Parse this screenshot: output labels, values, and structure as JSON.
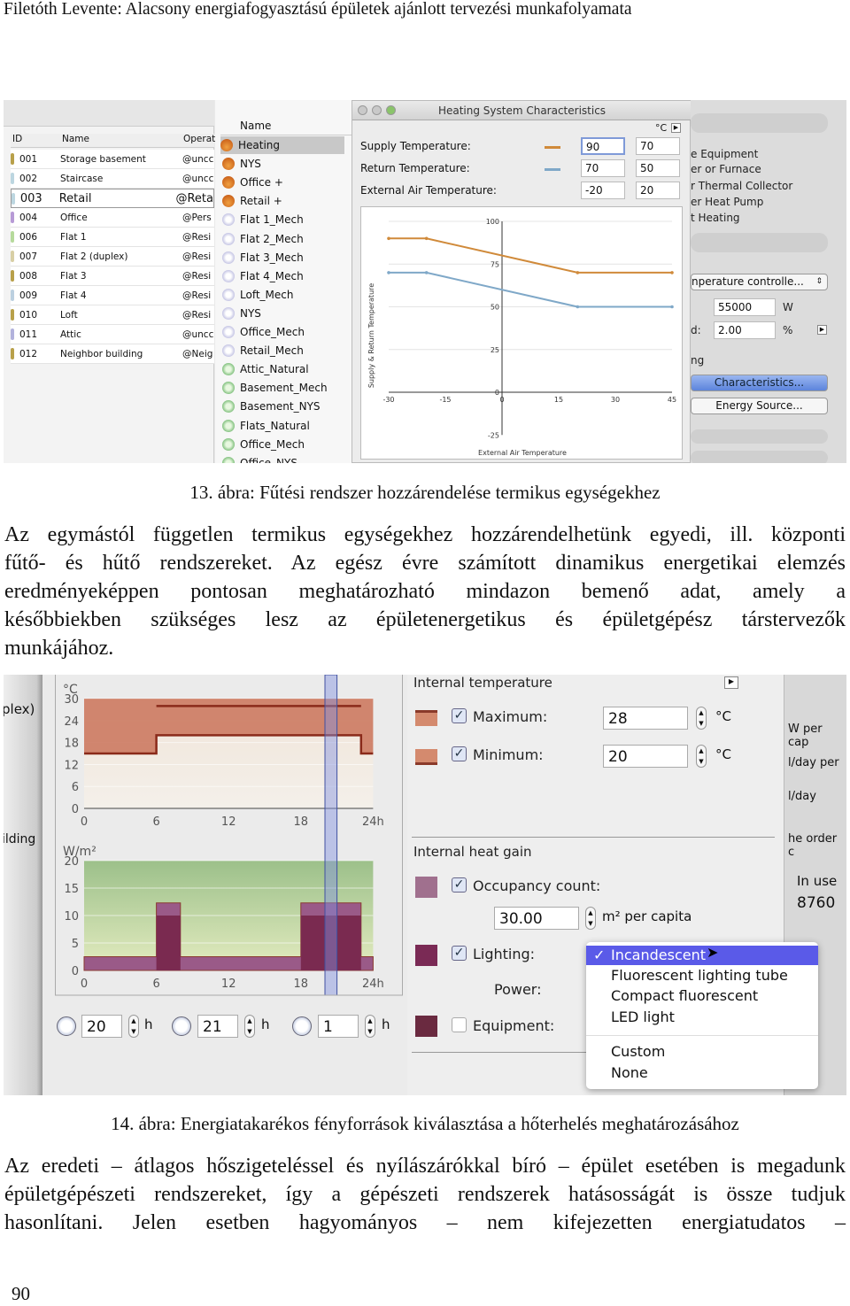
{
  "header": "Filetóth Levente: Alacsony energiafogyasztású épületek ajánlott tervezési munkafolyamata",
  "figure13": {
    "table": {
      "columns": [
        "ID",
        "Name",
        "Operat"
      ],
      "rows": [
        {
          "id": "001",
          "name": "Storage basement",
          "op": "@uncc",
          "color": "#b8a04a"
        },
        {
          "id": "002",
          "name": "Staircase",
          "op": "@uncc",
          "color": "#bcd6e0"
        },
        {
          "id": "003",
          "name": "Retail",
          "op": "@Reta",
          "color": "#bcd6e0"
        },
        {
          "id": "004",
          "name": "Office",
          "op": "@Pers",
          "color": "#b79ad6"
        },
        {
          "id": "006",
          "name": "Flat 1",
          "op": "@Resi",
          "color": "#b6da9c"
        },
        {
          "id": "007",
          "name": "Flat 2 (duplex)",
          "op": "@Resi",
          "color": "#d8cfa5"
        },
        {
          "id": "008",
          "name": "Flat 3",
          "op": "@Resi",
          "color": "#b8a04a"
        },
        {
          "id": "009",
          "name": "Flat 4",
          "op": "@Resi",
          "color": "#bcd0e0"
        },
        {
          "id": "010",
          "name": "Loft",
          "op": "@Resi",
          "color": "#b8a04a"
        },
        {
          "id": "011",
          "name": "Attic",
          "op": "@uncc",
          "color": "#b2b2dc"
        },
        {
          "id": "012",
          "name": "Neighbor building",
          "op": "@Neig",
          "color": "#b8a04a"
        }
      ]
    },
    "systems": {
      "header": "Name",
      "items": [
        {
          "label": "Heating",
          "icon": "flame-icon"
        },
        {
          "label": "NYS",
          "icon": "flame-icon"
        },
        {
          "label": "Office +",
          "icon": "flame-icon"
        },
        {
          "label": "Retail +",
          "icon": "flame-icon"
        },
        {
          "label": "Flat 1_Mech",
          "icon": "snowflake-icon"
        },
        {
          "label": "Flat 2_Mech",
          "icon": "snowflake-icon"
        },
        {
          "label": "Flat 3_Mech",
          "icon": "snowflake-icon"
        },
        {
          "label": "Flat 4_Mech",
          "icon": "snowflake-icon"
        },
        {
          "label": "Loft_Mech",
          "icon": "snowflake-icon"
        },
        {
          "label": "NYS",
          "icon": "snowflake-icon"
        },
        {
          "label": "Office_Mech",
          "icon": "snowflake-icon"
        },
        {
          "label": "Retail_Mech",
          "icon": "snowflake-icon"
        },
        {
          "label": "Attic_Natural",
          "icon": "fan-icon"
        },
        {
          "label": "Basement_Mech",
          "icon": "fan-icon"
        },
        {
          "label": "Basement_NYS",
          "icon": "fan-icon"
        },
        {
          "label": "Flats_Natural",
          "icon": "fan-icon"
        },
        {
          "label": "Office_Mech",
          "icon": "fan-icon"
        },
        {
          "label": "Office_NYS",
          "icon": "fan-icon"
        }
      ]
    },
    "dialog": {
      "title": "Heating System Characteristics",
      "unit": "°C",
      "supply_label": "Supply Temperature:",
      "supply_values": [
        "90",
        "70"
      ],
      "return_label": "Return Temperature:",
      "return_values": [
        "70",
        "50"
      ],
      "external_label": "External Air Temperature:",
      "external_values": [
        "-20",
        "20"
      ],
      "supply_color": "#d08a3a",
      "return_color": "#7fa8c8"
    },
    "right_panel": {
      "items": [
        "e Equipment",
        "er or Furnace",
        "r Thermal Collector",
        "er Heat Pump",
        "t Heating"
      ],
      "control": "nperature controlle...",
      "power_value": "55000",
      "power_unit": "W",
      "d_label": "d:",
      "d_value": "2.00",
      "d_unit": "%",
      "ng": "ng",
      "characteristics_button": "Characteristics...",
      "energy_button": "Energy Source..."
    },
    "caption": "13. ábra: Fűtési rendszer hozzárendelése termikus egységekhez"
  },
  "paragraph1": [
    "Az egymástól független termikus egységekhez hozzárendelhetünk egyedi, ill. központi",
    "fűtő- és hűtő rendszereket. Az egész évre számított dinamikus energetikai elemzés",
    "eredményeképpen pontosan meghatározható mindazon bemenő adat, amely a",
    "későbbiekben szükséges lesz az épületenergetikus és épületgépész társtervezők",
    "munkájához."
  ],
  "figure14": {
    "left_strip": [
      "plex)",
      "ilding"
    ],
    "controls": {
      "start": "20",
      "end": "21",
      "duration": "1",
      "unit": "h"
    },
    "internal_temperature": {
      "title": "Internal temperature",
      "max_label": "Maximum:",
      "max_value": "28",
      "max_checked": true,
      "min_label": "Minimum:",
      "min_value": "20",
      "min_checked": true,
      "unit": "°C"
    },
    "internal_heat_gain": {
      "title": "Internal heat gain",
      "occupancy_label": "Occupancy count:",
      "occupancy_value": "30.00",
      "occupancy_unit": "m² per capita",
      "occupancy_checked": true,
      "lighting_label": "Lighting:",
      "lighting_checked": true,
      "power_label": "Power:",
      "equipment_label": "Equipment:",
      "equipment_checked": false
    },
    "lighting_menu": {
      "selected": "Incandescent",
      "options": [
        "Incandescent",
        "Fluorescent lighting tube",
        "Compact fluorescent",
        "LED light"
      ],
      "options2": [
        "Custom",
        "None"
      ]
    },
    "far_panel": [
      "W per cap",
      "l/day per",
      "l/day",
      "he order c",
      "In use",
      "8760"
    ],
    "caption": "14. ábra: Energiatakarékos fényforrások kiválasztása a hőterhelés meghatározásához"
  },
  "paragraph2": [
    "Az eredeti – átlagos hőszigeteléssel és nyílászárókkal bíró – épület esetében is megadunk",
    "épületgépészeti rendszereket, így a gépészeti rendszerek hatásosságát is össze tudjuk",
    "hasonlítani. Jelen esetben hagyományos – nem kifejezetten energiatudatos –"
  ],
  "page_number": "90",
  "chart_data": [
    {
      "type": "line",
      "xlabel": "External Air Temperature",
      "ylabel": "Supply & Return Temperature",
      "xlim": [
        -30,
        45
      ],
      "ylim": [
        -25,
        100
      ],
      "xticks": [
        -30,
        -15,
        0,
        15,
        30,
        45
      ],
      "yticks": [
        -25,
        0,
        25,
        50,
        75,
        100
      ],
      "grid": true,
      "series": [
        {
          "x": [
            -30,
            -20,
            20,
            45
          ],
          "y": [
            90,
            90,
            70,
            70
          ],
          "color": "#d08a3a"
        },
        {
          "x": [
            -30,
            -20,
            20,
            45
          ],
          "y": [
            70,
            70,
            50,
            50
          ],
          "color": "#7fa8c8"
        }
      ]
    },
    {
      "type": "line",
      "ylabel": "°C",
      "xlim": [
        0,
        24
      ],
      "ylim": [
        0,
        30
      ],
      "xticks": [
        "0",
        "6",
        "12",
        "18",
        "24h"
      ],
      "yticks": [
        0,
        6,
        12,
        18,
        24,
        30
      ],
      "series": [
        {
          "x": [
            6,
            23
          ],
          "y": [
            28,
            28
          ],
          "color": "#8a2a1a"
        },
        {
          "x": [
            0,
            6,
            6,
            23,
            23,
            24
          ],
          "y": [
            15,
            15,
            20,
            20,
            15,
            15
          ],
          "color": "#8a2a1a"
        }
      ],
      "highlight_hours": [
        20,
        21
      ]
    },
    {
      "type": "area",
      "ylabel": "W/m²",
      "xlim": [
        0,
        24
      ],
      "ylim": [
        0,
        20
      ],
      "xticks": [
        "0",
        "6",
        "12",
        "18",
        "24h"
      ],
      "yticks": [
        0,
        5,
        10,
        15,
        20
      ],
      "series": [
        {
          "x": [
            0,
            6,
            6,
            8,
            8,
            18,
            18,
            23,
            23,
            24
          ],
          "y": [
            2.5,
            2.5,
            12.3,
            12.3,
            2.5,
            2.5,
            12.3,
            12.3,
            2.5,
            2.5
          ],
          "color": "#9a5a88"
        },
        {
          "x": [
            6,
            8,
            18,
            23
          ],
          "y": [
            10,
            10,
            10,
            10
          ],
          "color": "#7a2a50"
        }
      ],
      "highlight_hours": [
        20,
        21
      ]
    }
  ]
}
